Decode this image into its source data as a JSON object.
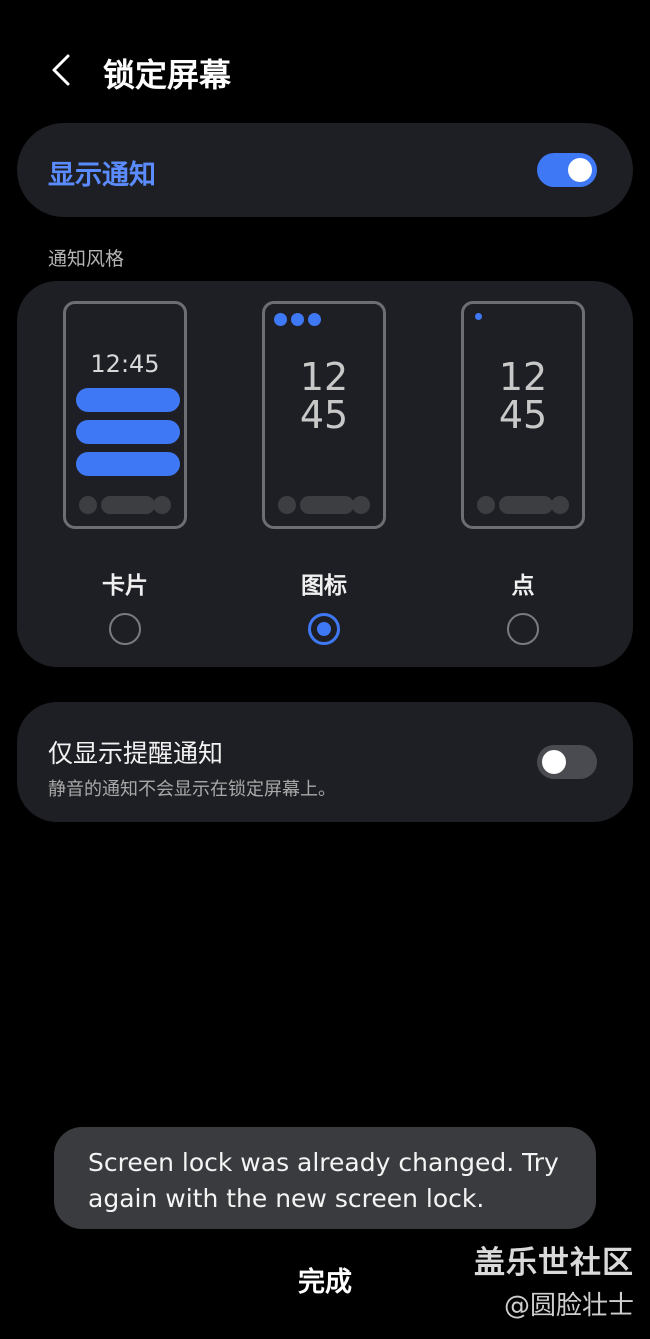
{
  "header": {
    "title": "锁定屏幕",
    "back_icon": "chevron-left-icon"
  },
  "show_notifications": {
    "label": "显示通知",
    "enabled": true
  },
  "notification_style": {
    "section_label": "通知风格",
    "options": [
      {
        "label": "卡片",
        "preview_time": "12:45",
        "selected": false
      },
      {
        "label": "图标",
        "preview_hour": "12",
        "preview_minute": "45",
        "selected": true
      },
      {
        "label": "点",
        "preview_hour": "12",
        "preview_minute": "45",
        "selected": false
      }
    ]
  },
  "alert_only": {
    "title": "仅显示提醒通知",
    "subtitle": "静音的通知不会显示在锁定屏幕上。",
    "enabled": false
  },
  "toast": {
    "message": "Screen lock was already changed. Try again with the new screen lock."
  },
  "footer": {
    "done_label": "完成"
  },
  "watermark": {
    "line1": "盖乐世社区",
    "line2": "@圆脸壮士"
  },
  "colors": {
    "accent": "#3f78f5",
    "label_accent": "#5b8cff",
    "card_bg": "#1e1f24",
    "page_bg": "#000000"
  }
}
